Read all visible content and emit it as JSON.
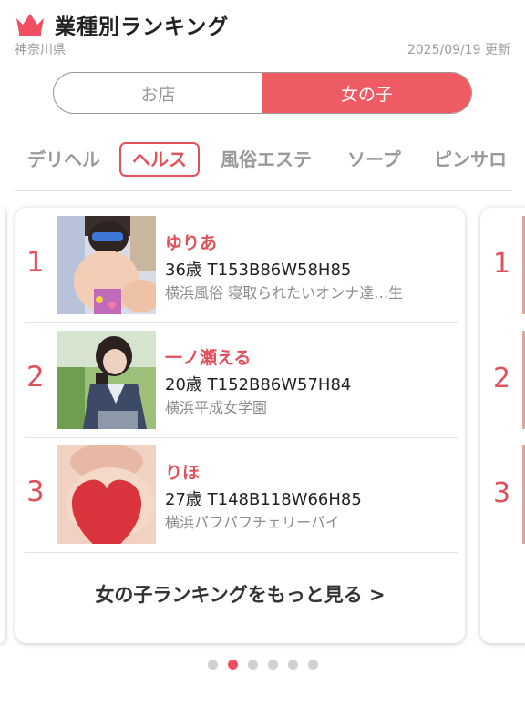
{
  "header": {
    "title": "業種別ランキング",
    "region": "神奈川県",
    "updated": "2025/09/19 更新"
  },
  "toggle": {
    "options": [
      {
        "label": "お店",
        "active": false
      },
      {
        "label": "女の子",
        "active": true
      }
    ]
  },
  "categories": [
    {
      "label": "デリヘル",
      "active": false
    },
    {
      "label": "ヘルス",
      "active": true
    },
    {
      "label": "風俗エステ",
      "active": false
    },
    {
      "label": "ソープ",
      "active": false
    },
    {
      "label": "ピンサロ",
      "active": false
    }
  ],
  "ranking": [
    {
      "rank": "1",
      "name": "ゆりあ",
      "stats": "36歳 T153B86W58H85",
      "shop": "横浜風俗 寝取られたいオンナ達…生"
    },
    {
      "rank": "2",
      "name": "一ノ瀬える",
      "stats": "20歳 T152B86W57H84",
      "shop": "横浜平成女学園"
    },
    {
      "rank": "3",
      "name": "りほ",
      "stats": "27歳 T148B118W66H85",
      "shop": "横浜パフパフチェリーパイ"
    }
  ],
  "next_card_ranks": [
    "1",
    "2",
    "3"
  ],
  "more_link": "女の子ランキングをもっと見る >",
  "pagination": {
    "count": 6,
    "active_index": 1
  },
  "colors": {
    "accent": "#ef5b63",
    "rank": "#e0525b",
    "muted": "#9a9a9a"
  }
}
